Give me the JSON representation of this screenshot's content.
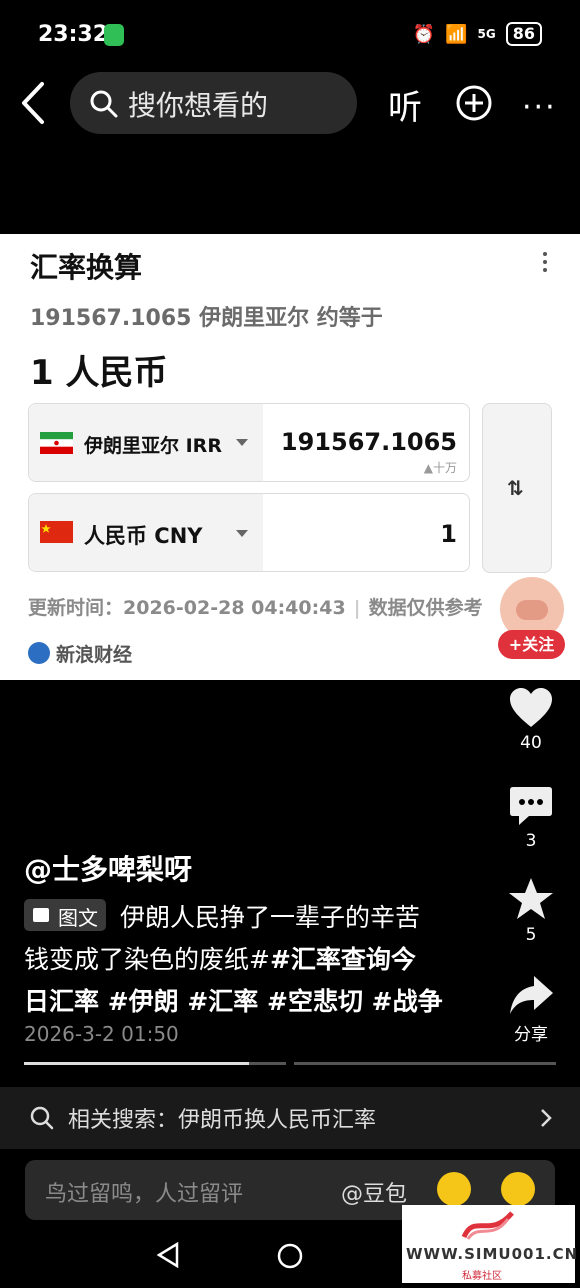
{
  "status_bar": {
    "time": "23:32",
    "network": "5G",
    "battery": "86"
  },
  "top_bar": {
    "search_placeholder": "搜你想看的",
    "listen_label": "听"
  },
  "card": {
    "title": "汇率换算",
    "summary": "191567.1065 伊朗里亚尔 约等于",
    "result": "1 人民币",
    "from": {
      "currency_label": "伊朗里亚尔 IRR",
      "amount": "191567.1065",
      "unit_hint": "十万"
    },
    "to": {
      "currency_label": "人民币 CNY",
      "amount": "1"
    },
    "swap_icon": "⇅",
    "update_text": "更新时间：2026-02-28 04:40:43",
    "disclaimer": "数据仅供参考",
    "source": "新浪财经"
  },
  "follow": {
    "label": "+关注"
  },
  "rail": {
    "likes": "40",
    "comments": "3",
    "favorites": "5",
    "share_label": "分享"
  },
  "post": {
    "author": "@士多啤梨呀",
    "type_badge": "图文",
    "caption_line1": "伊朗人民挣了一辈子的辛苦",
    "caption_line2": "钱变成了染色的废纸#",
    "caption_line2_tag": "#汇率查询今",
    "caption_line3": "日汇率 #伊朗 #汇率 #空悲切 #战争",
    "date": "2026-3-2 01:50"
  },
  "related": {
    "text": "相关搜索：伊朗币换人民币汇率"
  },
  "comment": {
    "placeholder": "鸟过留鸣，人过留评",
    "mention": "@豆包"
  },
  "watermark": {
    "site": "WWW.SIMU001.CN",
    "sub": "私募社区"
  },
  "colors": {
    "accent_red": "#e0323c",
    "card_bg": "#ffffff",
    "page_bg": "#000000"
  }
}
